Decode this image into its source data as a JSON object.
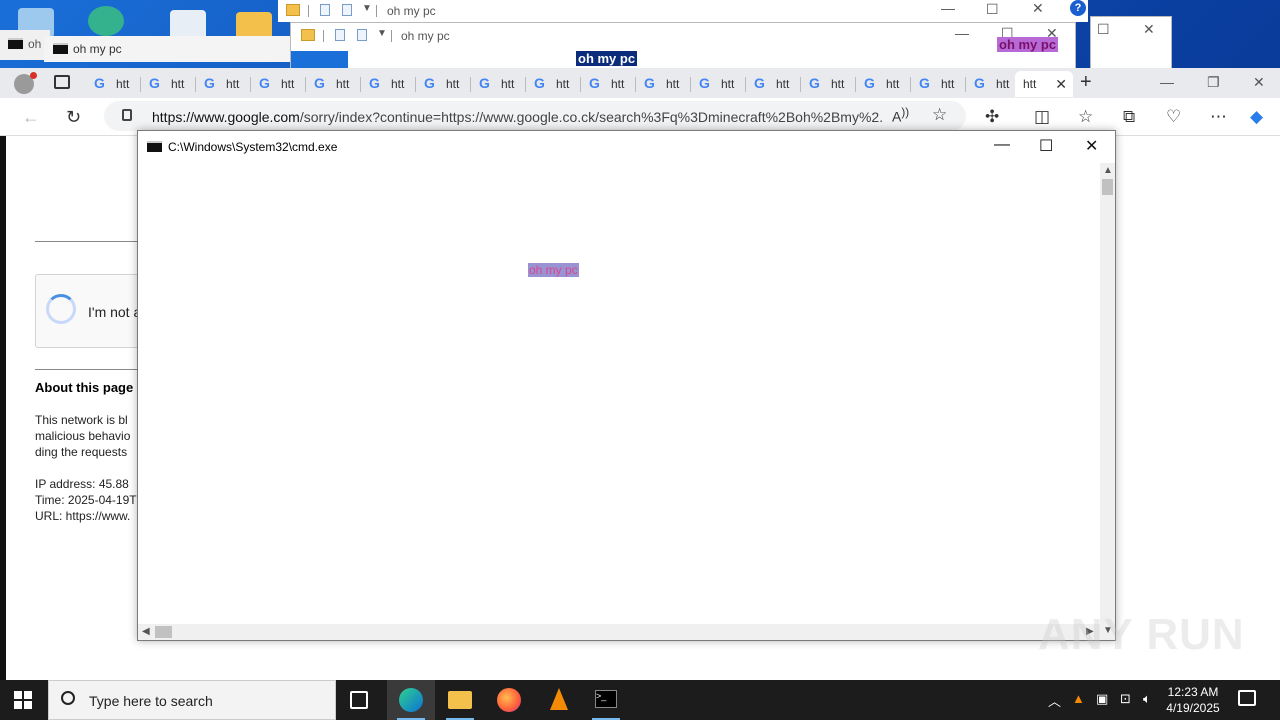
{
  "background_windows": {
    "cmd_title_1": "oh",
    "cmd_title_2": "oh my pc",
    "explorer_title_1": "oh my pc",
    "explorer_title_2": "oh my pc",
    "highlight_blue": "oh my pc",
    "highlight_pink": "oh my pc",
    "help_glyph": "?"
  },
  "browser": {
    "tab_label": "htt",
    "active_tab_label": "htt",
    "tab_count_inactive": 17,
    "url_host": "https://www.google.com",
    "url_rest": "/sorry/index?continue=https://www.google.co.ck/search%3Fq%3Dminecraft%2Boh%2Bmy%2..."
  },
  "page": {
    "captcha_label": "I'm not a",
    "about_heading": "About this page",
    "para_1": "This network is bl",
    "para_2": "malicious behavio",
    "para_3": "ding the requests",
    "ip_line": "IP address: 45.88",
    "time_line": "Time: 2025-04-19T",
    "url_line": "URL: https://www."
  },
  "cmd": {
    "title": "C:\\Windows\\System32\\cmd.exe",
    "overlay_text": "oh my pc"
  },
  "watermark": "ANY RUN",
  "taskbar": {
    "search_placeholder": "Type here to search",
    "time": "12:23 AM",
    "date": "4/19/2025"
  }
}
